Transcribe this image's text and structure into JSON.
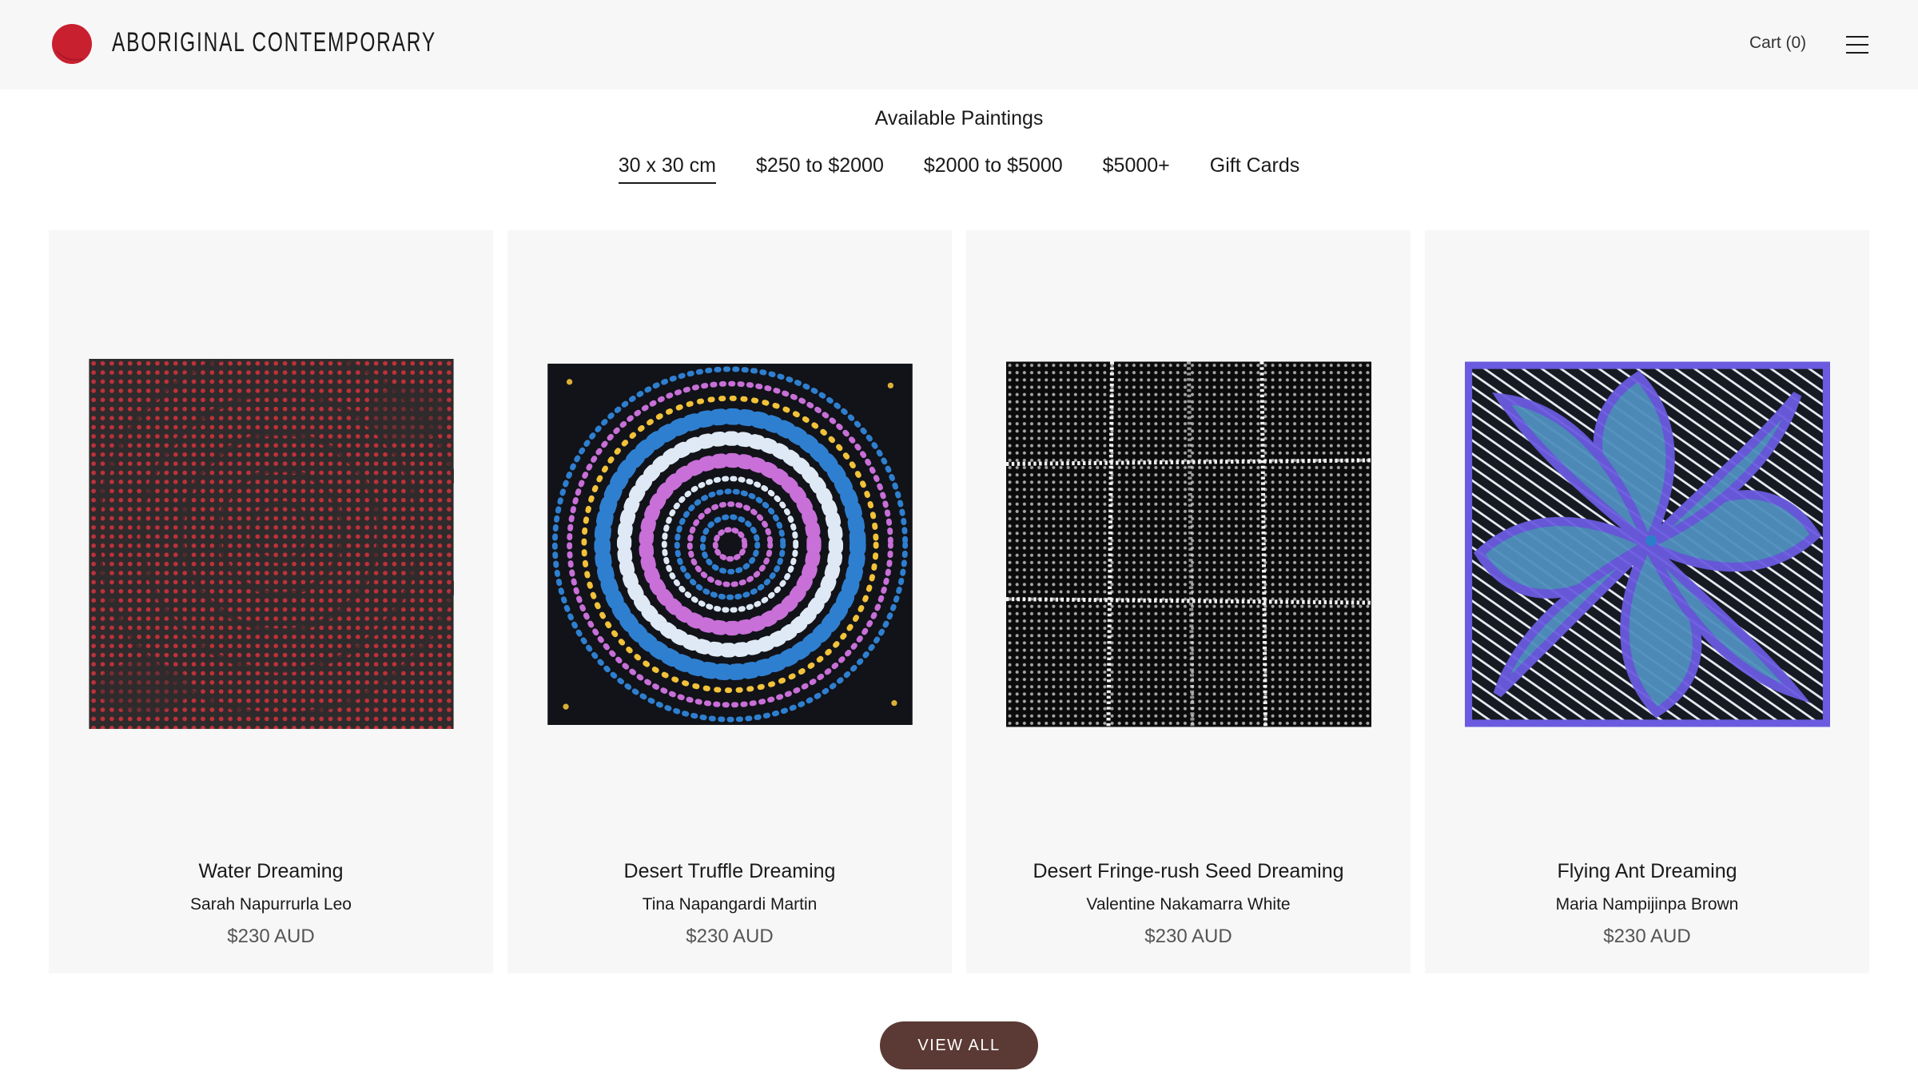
{
  "header": {
    "brand": "ABORIGINAL CONTEMPORARY",
    "cart_label": "Cart (0)",
    "logo_color": "#c8202f",
    "menu_icon": "hamburger-menu-icon"
  },
  "collection": {
    "title": "Available Paintings",
    "filters": [
      {
        "label": "30 x 30 cm",
        "active": true
      },
      {
        "label": "$250 to $2000",
        "active": false
      },
      {
        "label": "$2000 to $5000",
        "active": false
      },
      {
        "label": "$5000+",
        "active": false
      },
      {
        "label": "Gift Cards",
        "active": false
      }
    ]
  },
  "products": [
    {
      "title": "Water Dreaming",
      "artist": "Sarah Napurrurla Leo",
      "price": "$230 AUD"
    },
    {
      "title": "Desert Truffle Dreaming",
      "artist": "Tina Napangardi Martin",
      "price": "$230 AUD"
    },
    {
      "title": "Desert Fringe-rush Seed Dreaming",
      "artist": "Valentine Nakamarra White",
      "price": "$230 AUD"
    },
    {
      "title": "Flying Ant Dreaming",
      "artist": "Maria Nampijinpa Brown",
      "price": "$230 AUD"
    }
  ],
  "view_all_label": "VIEW ALL",
  "colors": {
    "button_bg": "#5b3934",
    "card_bg": "#f7f7f7"
  }
}
